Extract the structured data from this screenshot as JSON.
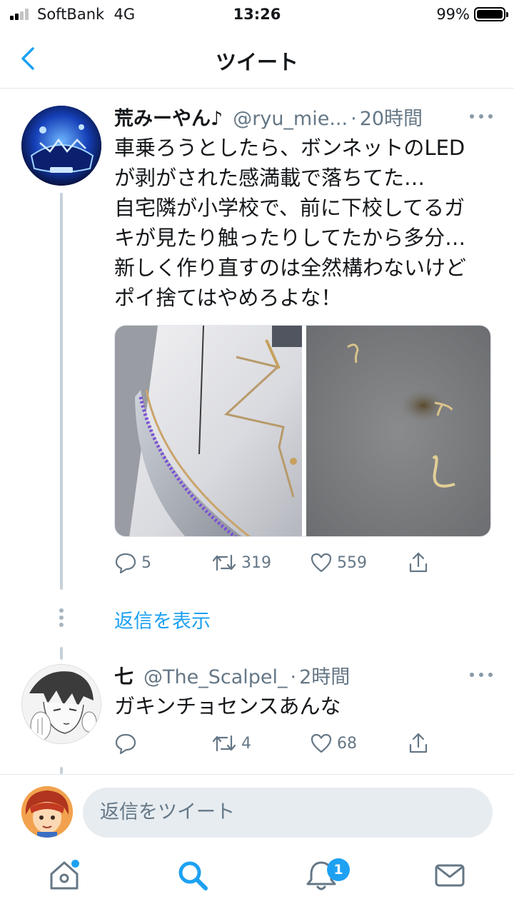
{
  "status_bar": {
    "carrier": "SoftBank",
    "network": "4G",
    "time": "13:26",
    "battery_percent": "99%",
    "battery_level": 0.99
  },
  "nav": {
    "title": "ツイート"
  },
  "main_tweet": {
    "display_name": "荒みーやん♪",
    "handle": "@ryu_mie...",
    "separator": "·",
    "time_ago": "20時間",
    "text_lines": [
      "車乗ろうとしたら、ボンネットのLED",
      "が剥がされた感満載で落ちてた…",
      "自宅隣が小学校で、前に下校してるガ",
      "キが見たり触ったりしてたから多分…",
      "新しく作り直すのは全然構わないけど",
      "ポイ捨てはやめろよな！"
    ],
    "reply_count": "5",
    "retweet_count": "319",
    "like_count": "559"
  },
  "show_replies": "返信を表示",
  "reply_tweet": {
    "display_name": "七",
    "handle": "@The_Scalpel_",
    "separator": "·",
    "time_ago": "2時間",
    "text": "ガキンチョセンスあんな",
    "reply_count": "",
    "retweet_count": "4",
    "like_count": "68"
  },
  "compose": {
    "placeholder": "返信をツイート"
  },
  "tab_bar": {
    "notification_badge": "1",
    "icons": [
      "home-icon",
      "search-icon",
      "notifications-icon",
      "messages-icon"
    ]
  },
  "colors": {
    "accent": "#1da1f2",
    "text": "#14171a",
    "muted": "#657786",
    "divider": "#e1e8ed"
  }
}
